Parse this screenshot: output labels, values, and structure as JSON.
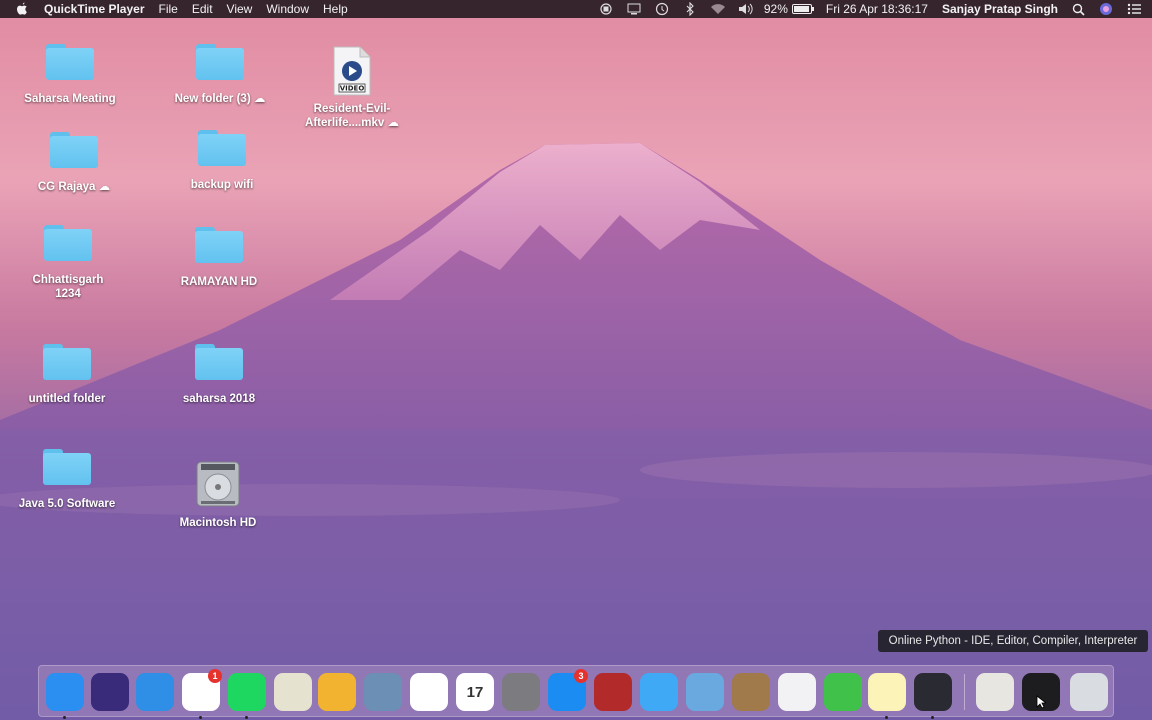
{
  "menubar": {
    "app_name": "QuickTime Player",
    "menus": [
      "File",
      "Edit",
      "View",
      "Window",
      "Help"
    ],
    "battery_percent": "92%",
    "battery_level": 0.92,
    "clock": "Fri 26 Apr  18:36:17",
    "user": "Sanjay Pratap Singh"
  },
  "desktop": {
    "icons": [
      {
        "label": "Saharsa Meating",
        "kind": "folder"
      },
      {
        "label": "New folder (3) ☁",
        "kind": "folder"
      },
      {
        "label": "Resident-Evil-Afterlife....mkv ☁",
        "kind": "video",
        "file_badge": "VIDEO"
      },
      {
        "label": "CG Rajaya ☁",
        "kind": "folder"
      },
      {
        "label": "backup wifi",
        "kind": "folder"
      },
      {
        "label": "Chhattisgarh 1234",
        "kind": "folder"
      },
      {
        "label": "RAMAYAN HD",
        "kind": "folder"
      },
      {
        "label": "untitled folder",
        "kind": "folder"
      },
      {
        "label": "saharsa 2018",
        "kind": "folder"
      },
      {
        "label": "Java 5.0 Software",
        "kind": "folder"
      },
      {
        "label": "Macintosh HD",
        "kind": "drive"
      }
    ]
  },
  "dock": {
    "items": [
      {
        "name": "finder-icon",
        "color": "#2a8ff0",
        "running": true
      },
      {
        "name": "siri-icon",
        "color": "#3a2a7a",
        "running": false
      },
      {
        "name": "safari-icon",
        "color": "#2f8ee6",
        "running": false
      },
      {
        "name": "chrome-icon",
        "color": "#ffffff",
        "running": true,
        "badge": "1"
      },
      {
        "name": "spotify-icon",
        "color": "#1ed760",
        "running": true
      },
      {
        "name": "maps-icon",
        "color": "#e6e2d0",
        "running": false
      },
      {
        "name": "game-center-icon",
        "color": "#f2b430",
        "running": false
      },
      {
        "name": "preview-icon",
        "color": "#6b8fb5",
        "running": false
      },
      {
        "name": "photos-icon",
        "color": "#ffffff",
        "running": false
      },
      {
        "name": "calendar-icon",
        "color": "#ffffff",
        "running": false,
        "text": "17"
      },
      {
        "name": "system-preferences-icon",
        "color": "#7c7c80",
        "running": false
      },
      {
        "name": "app-store-icon",
        "color": "#1b8cf2",
        "running": false,
        "badge": "3"
      },
      {
        "name": "photo-booth-icon",
        "color": "#b32a2a",
        "running": false
      },
      {
        "name": "messages-icon",
        "color": "#3fa9f5",
        "running": false
      },
      {
        "name": "mail-icon",
        "color": "#6aa8e0",
        "running": false
      },
      {
        "name": "contacts-icon",
        "color": "#a07a4a",
        "running": false
      },
      {
        "name": "itunes-icon",
        "color": "#f2f2f5",
        "running": false
      },
      {
        "name": "facetime-icon",
        "color": "#40c24a",
        "running": false
      },
      {
        "name": "notes-icon",
        "color": "#fbf3b8",
        "running": true
      },
      {
        "name": "quicktime-icon",
        "color": "#2a2a33",
        "running": true
      },
      {
        "name": "documents-stack-icon",
        "color": "#e8e6e0",
        "running": false
      },
      {
        "name": "chrome-window-icon",
        "color": "#1d1d1f",
        "running": false
      },
      {
        "name": "trash-icon",
        "color": "#d9dce0",
        "running": false
      }
    ],
    "tooltip": "Online Python - IDE, Editor, Compiler, Interpreter"
  }
}
